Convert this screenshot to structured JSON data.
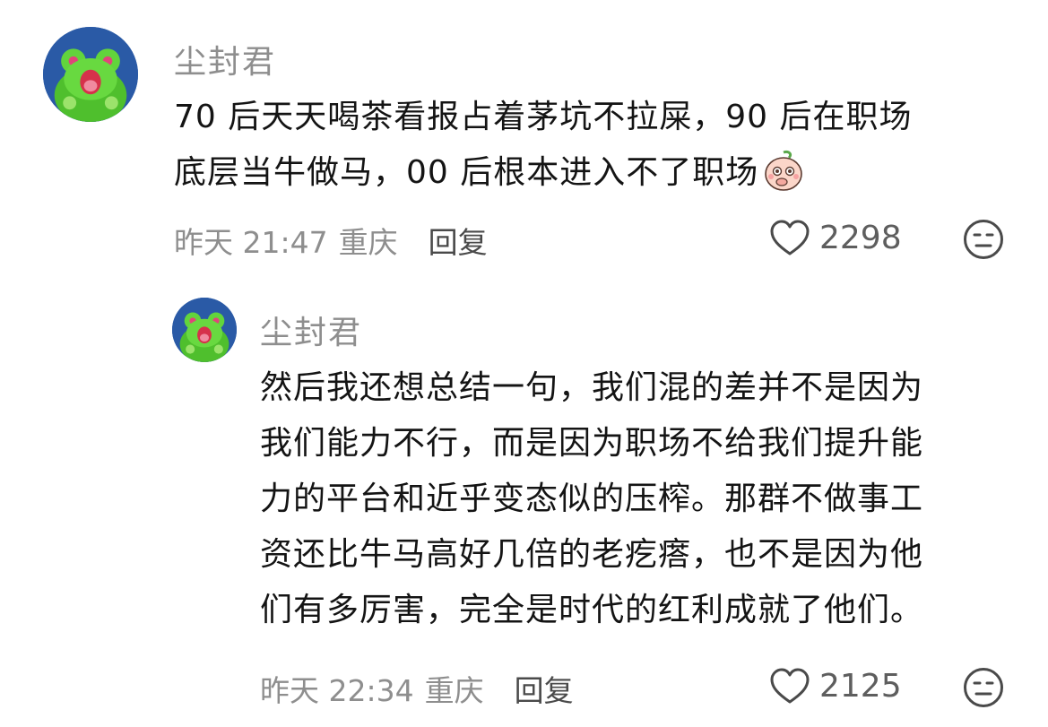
{
  "comment": {
    "username": "尘封君",
    "avatar_icon": "green-frog-avatar-icon",
    "text_lines": [
      "70 后天天喝茶看报占着茅坑不拉屎，90 后在职场",
      "底层当牛做马，00 后根本进入不了职场"
    ],
    "emoji_icon": "peach-covering-mouth-emoji-icon",
    "time": "昨天 21:47",
    "location": "重庆",
    "reply_label": "回复",
    "likes": "2298",
    "like_icon": "heart-icon",
    "dislike_icon": "meh-face-icon"
  },
  "reply": {
    "username": "尘封君",
    "avatar_icon": "green-frog-avatar-icon",
    "text_lines": [
      "然后我还想总结一句，我们混的差并不是因为",
      "我们能力不行，而是因为职场不给我们提升能",
      "力的平台和近乎变态似的压榨。那群不做事工",
      "资还比牛马高好几倍的老疙瘩，也不是因为他",
      "们有多厉害，完全是时代的红利成就了他们。"
    ],
    "time": "昨天 22:34",
    "location": "重庆",
    "reply_label": "回复",
    "likes": "2125",
    "like_icon": "heart-icon",
    "dislike_icon": "meh-face-icon"
  },
  "colors": {
    "text": "#141414",
    "meta": "#8e8e8e",
    "avatar_bg": "#2a5aa6",
    "frog_green": "#5fd13a"
  }
}
